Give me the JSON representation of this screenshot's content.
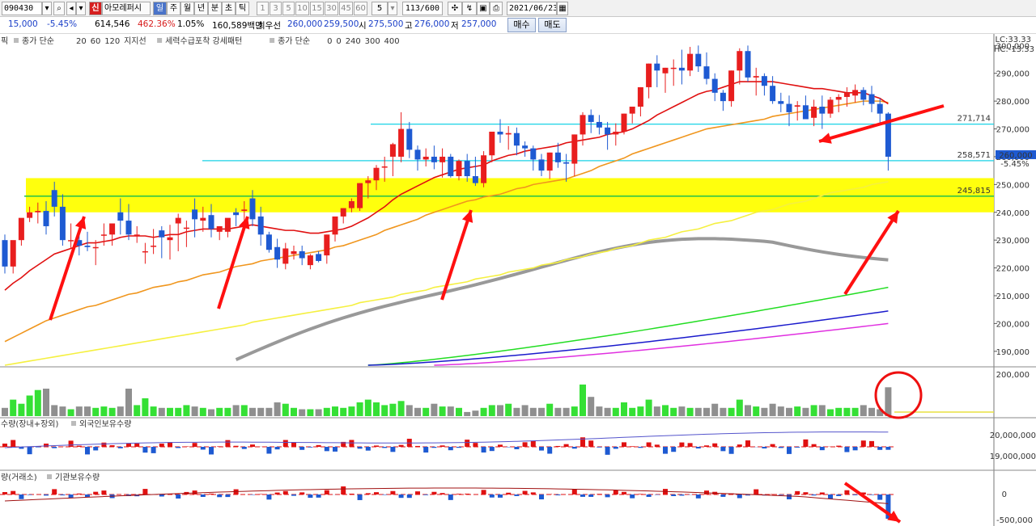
{
  "toolbar": {
    "code": "090430",
    "name_badge": "신",
    "name": "아모레퍼시",
    "periods": [
      "일",
      "주",
      "월",
      "년",
      "분",
      "초",
      "틱"
    ],
    "intervals": [
      "1",
      "3",
      "5",
      "10",
      "15",
      "30",
      "45",
      "60"
    ],
    "count_value": "5",
    "page": "113/600",
    "date": "2021/06/23"
  },
  "info": {
    "val1": "15,000",
    "change_pct": "-5.45%",
    "volume": "614,546",
    "ratio": "462.36%",
    "turnover": "1.05%",
    "amount": "160,589백만",
    "best_bid_label": "최우선",
    "best_bid": "260,000",
    "best_ask": "259,500",
    "open_label": "시",
    "open": "275,500",
    "high_label": "고",
    "high": "276,000",
    "low_label": "저",
    "low": "257,000",
    "buy_btn": "매수",
    "sell_btn": "매도"
  },
  "legend": {
    "prefix": "픽",
    "sma_label": "종가 단순",
    "sma_periods": [
      "20",
      "60",
      "120"
    ],
    "support_label": "지지선",
    "pattern_label": "세력수급포착 강세패턴",
    "sma2_label": "종가 단순",
    "sma2_periods": [
      "0",
      "0",
      "240",
      "300",
      "400"
    ]
  },
  "lc_hc": {
    "lc": "LC:33.33",
    "hc": "HC:-13.33"
  },
  "price_axis": [
    "300,000",
    "290,000",
    "280,000",
    "270,000",
    "260,000",
    "250,000",
    "240,000",
    "230,000",
    "220,000",
    "210,000",
    "200,000",
    "190,000"
  ],
  "current_price": {
    "value": "260,000",
    "pct": "-5.45%"
  },
  "levels": [
    {
      "label": "271,714",
      "value": 271714
    },
    {
      "label": "258,571",
      "value": 258571
    },
    {
      "label": "245,815",
      "value": 245815
    }
  ],
  "volume_axis": [
    "200,000"
  ],
  "panel3": {
    "title1": "수량(장내+장외)",
    "title2": "외국인보유수량",
    "axis": [
      "20,000,000",
      "19,000,000"
    ]
  },
  "panel4": {
    "title1": "량(거래소)",
    "title2": "기관보유수량",
    "axis": [
      "0",
      "-500,000"
    ]
  },
  "colors": {
    "up": "#e81e1e",
    "down": "#1e5ad2",
    "sma20": "#e01010",
    "sma60": "#f0961e",
    "sma120": "#ffff32",
    "highlight": "#ffff00",
    "level_line": "#19d2e6"
  },
  "chart_data": {
    "type": "candlestick",
    "title": "",
    "ylim": [
      185000,
      303000
    ],
    "yscale_note": "price",
    "candles_o": [
      230000,
      220500,
      230000,
      238000,
      240000,
      240500,
      248000,
      242000,
      230000,
      230000,
      228000,
      227500,
      232000,
      232000,
      240000,
      237000,
      232000,
      226000,
      228000,
      233500,
      230000,
      236000,
      234500,
      241000,
      237000,
      239000,
      233000,
      233000,
      240000,
      240500,
      245000,
      238500,
      232000,
      227500,
      221500,
      225000,
      226000,
      221000,
      225000,
      224500,
      232000,
      238500,
      241500,
      241500,
      250500,
      251500,
      256500,
      260000,
      260000,
      270000,
      262500,
      259000,
      260000,
      258000,
      260000,
      253000,
      258500,
      253000,
      250500,
      260500,
      269000,
      268000,
      268500,
      264000,
      263000,
      259000,
      255000,
      261500,
      258000,
      257500,
      268000,
      275000,
      272500,
      270500,
      268000,
      269000,
      275500,
      278000,
      285000,
      293500,
      290000,
      292000,
      292000,
      291000,
      297000,
      292500,
      288000,
      283000,
      280000,
      291000,
      298000,
      288500,
      289000,
      285500,
      280000,
      279000,
      278000,
      278500,
      274000,
      278000,
      275500,
      280500,
      281500,
      282000,
      284000,
      282500,
      279000,
      275500
    ],
    "candles_h": [
      232000,
      223500,
      235000,
      242000,
      243500,
      244000,
      251000,
      246500,
      236000,
      234000,
      233000,
      230000,
      236000,
      236000,
      245000,
      243000,
      235000,
      229000,
      234000,
      235000,
      235500,
      239500,
      237000,
      245000,
      242000,
      243000,
      235000,
      236000,
      241500,
      244000,
      248000,
      242000,
      233000,
      230500,
      229000,
      228000,
      228000,
      225000,
      226000,
      232000,
      238000,
      241500,
      245000,
      250500,
      253000,
      257000,
      260000,
      265000,
      276000,
      272500,
      264000,
      263000,
      264000,
      263000,
      261000,
      259000,
      261000,
      260000,
      262000,
      269000,
      273500,
      271000,
      270500,
      265500,
      264000,
      261000,
      261500,
      265000,
      261000,
      268000,
      276000,
      277000,
      275000,
      272500,
      272000,
      275500,
      278000,
      285000,
      293500,
      296500,
      292000,
      295000,
      298500,
      299500,
      300000,
      297500,
      290000,
      284000,
      291000,
      299000,
      300000,
      292000,
      290000,
      289000,
      283000,
      282000,
      280000,
      282000,
      280500,
      282000,
      281500,
      282500,
      285000,
      286000,
      285000,
      285500,
      281000,
      276000
    ],
    "candles_l": [
      218000,
      218000,
      228000,
      236500,
      236000,
      232000,
      238500,
      228000,
      227000,
      224500,
      226000,
      221000,
      228000,
      228000,
      232000,
      230000,
      229000,
      221500,
      225000,
      223500,
      223000,
      226000,
      227500,
      231000,
      233000,
      231000,
      230000,
      231000,
      235000,
      237000,
      235000,
      228000,
      225500,
      220000,
      219500,
      223000,
      221000,
      219500,
      222000,
      221500,
      229500,
      236000,
      240000,
      240500,
      245000,
      248000,
      251000,
      253000,
      258000,
      259500,
      255000,
      256500,
      255500,
      252500,
      252500,
      251500,
      251000,
      249500,
      249000,
      258000,
      265000,
      262500,
      260500,
      260000,
      255000,
      253000,
      252000,
      256000,
      251000,
      253000,
      264000,
      268500,
      268000,
      262500,
      264000,
      268000,
      272000,
      274500,
      281000,
      285000,
      283000,
      285500,
      286000,
      289000,
      290500,
      286000,
      280000,
      276500,
      278000,
      286000,
      287000,
      282000,
      282000,
      279000,
      276000,
      271000,
      273000,
      274500,
      271000,
      270000,
      274000,
      276000,
      278000,
      279500,
      278500,
      276000,
      272000,
      255000
    ],
    "candles_c": [
      220500,
      230000,
      238000,
      240000,
      240500,
      235000,
      242000,
      230000,
      230000,
      228000,
      227500,
      227500,
      232000,
      236000,
      237000,
      232000,
      232000,
      226000,
      228000,
      231000,
      231000,
      238000,
      234500,
      237500,
      238000,
      234000,
      235000,
      238000,
      239000,
      241000,
      237500,
      232000,
      226500,
      223000,
      227000,
      226000,
      223500,
      224500,
      222500,
      232000,
      238500,
      241500,
      244000,
      250500,
      251500,
      256000,
      256500,
      264500,
      270000,
      262500,
      259000,
      260000,
      258000,
      260000,
      253000,
      258500,
      253000,
      250500,
      260500,
      269000,
      268000,
      268500,
      264000,
      263000,
      259000,
      255000,
      261500,
      258000,
      257500,
      268000,
      275000,
      272500,
      270500,
      268000,
      269000,
      275500,
      278000,
      285000,
      293500,
      291000,
      292000,
      292000,
      291000,
      297000,
      292500,
      288000,
      283000,
      280000,
      291000,
      298000,
      288500,
      289000,
      285500,
      280000,
      279000,
      276000,
      278500,
      273500,
      278000,
      275500,
      280500,
      281500,
      283000,
      284000,
      280500,
      279000,
      275500,
      260000
    ],
    "sma20": [
      212000,
      214500,
      216500,
      219000,
      221000,
      223000,
      225000,
      226000,
      227000,
      228000,
      229000,
      229000,
      229500,
      230000,
      231000,
      231500,
      231500,
      231500,
      231000,
      231500,
      232000,
      232000,
      233000,
      233500,
      234000,
      234000,
      234000,
      234000,
      234500,
      235000,
      235500,
      235000,
      234500,
      234000,
      233500,
      233500,
      233000,
      232500,
      232500,
      233000,
      233500,
      234000,
      235000,
      236500,
      238000,
      240000,
      242000,
      244500,
      246500,
      248000,
      249500,
      251000,
      252500,
      253500,
      254500,
      255500,
      256000,
      256500,
      257000,
      258500,
      259500,
      260500,
      261000,
      262000,
      262500,
      263000,
      263500,
      264000,
      265000,
      265500,
      266000,
      266500,
      267000,
      268000,
      268500,
      269000,
      270000,
      271500,
      273000,
      275000,
      276500,
      278000,
      279500,
      281000,
      282500,
      283500,
      284000,
      285000,
      286000,
      287000,
      287000,
      287000,
      287000,
      287000,
      286500,
      286000,
      285500,
      285000,
      284500,
      284500,
      284000,
      283500,
      283000,
      283000,
      283000,
      282000,
      281000,
      279000
    ],
    "sma60": [
      193500,
      195000,
      196500,
      198000,
      199500,
      201000,
      202000,
      203000,
      204000,
      205000,
      206000,
      206500,
      207500,
      208500,
      209500,
      210500,
      211000,
      212000,
      213000,
      213500,
      214000,
      215000,
      215500,
      216500,
      217500,
      218000,
      218500,
      219500,
      220500,
      221000,
      221500,
      222500,
      223000,
      223500,
      224000,
      224500,
      225000,
      225500,
      226000,
      226500,
      227500,
      228000,
      229000,
      230000,
      231000,
      232000,
      233500,
      234500,
      235500,
      236500,
      237500,
      239000,
      240000,
      241000,
      242000,
      243000,
      244000,
      244500,
      245500,
      246000,
      246500,
      247500,
      248500,
      249000,
      250000,
      250500,
      251000,
      251500,
      252000,
      253000,
      254000,
      255000,
      256500,
      257500,
      258500,
      259500,
      261000,
      262000,
      263000,
      264000,
      265000,
      266000,
      267000,
      268000,
      269000,
      270000,
      270500,
      271000,
      271500,
      272000,
      272500,
      273000,
      273500,
      274500,
      275000,
      275500,
      276000,
      276500,
      277000,
      277500,
      278000,
      278500,
      279000,
      279500,
      280000,
      280000,
      280000,
      279500
    ],
    "sma120": [
      185000,
      185500,
      186000,
      186500,
      187000,
      187500,
      188000,
      188500,
      189000,
      189500,
      190000,
      190500,
      191000,
      191500,
      192000,
      192500,
      193000,
      193500,
      194000,
      194500,
      195000,
      195500,
      196000,
      196500,
      197000,
      197500,
      198000,
      198500,
      199000,
      199500,
      200500,
      201000,
      201500,
      202000,
      202500,
      203000,
      203500,
      204000,
      204500,
      205000,
      205500,
      206000,
      206500,
      207500,
      208000,
      208500,
      209000,
      209500,
      210500,
      211000,
      211500,
      212000,
      213000,
      213500,
      214000,
      214500,
      215000,
      216000,
      216500,
      217000,
      217500,
      218500,
      219000,
      219500,
      220000,
      221000,
      221500,
      222000,
      223000,
      223500,
      224000,
      225000,
      225500,
      226000,
      227000,
      227500,
      228000,
      229000,
      230000,
      230500,
      231000,
      232000,
      233000,
      233500,
      234000,
      235000,
      236000,
      236500,
      237000,
      238000,
      239000,
      240000,
      240500,
      241000,
      242000,
      243000,
      243500,
      244000,
      245000,
      246000,
      247000,
      247500,
      248000,
      248500,
      249000,
      250000,
      250500,
      251000
    ],
    "volume": [
      0.3,
      0.6,
      0.45,
      0.75,
      0.95,
      1.0,
      0.4,
      0.35,
      0.25,
      0.35,
      0.35,
      0.3,
      0.35,
      0.3,
      0.35,
      1.0,
      0.4,
      0.65,
      0.35,
      0.3,
      0.3,
      0.3,
      0.4,
      0.35,
      0.3,
      0.25,
      0.3,
      0.3,
      0.4,
      0.4,
      0.3,
      0.3,
      0.3,
      0.5,
      0.45,
      0.3,
      0.25,
      0.25,
      0.25,
      0.3,
      0.35,
      0.3,
      0.35,
      0.5,
      0.6,
      0.5,
      0.4,
      0.45,
      0.55,
      0.4,
      0.3,
      0.3,
      0.45,
      0.35,
      0.35,
      0.3,
      0.15,
      0.2,
      0.3,
      0.4,
      0.4,
      0.45,
      0.3,
      0.4,
      0.3,
      0.3,
      0.45,
      0.3,
      0.3,
      0.35,
      1.15,
      0.7,
      0.35,
      0.3,
      0.3,
      0.5,
      0.3,
      0.35,
      0.6,
      0.35,
      0.4,
      0.3,
      0.35,
      0.3,
      0.3,
      0.3,
      0.45,
      0.3,
      0.3,
      0.6,
      0.4,
      0.35,
      0.3,
      0.45,
      0.35,
      0.3,
      0.35,
      0.3,
      0.4,
      0.4,
      0.25,
      0.3,
      0.3,
      0.3,
      0.4,
      0.3,
      0.25,
      1.05
    ]
  }
}
